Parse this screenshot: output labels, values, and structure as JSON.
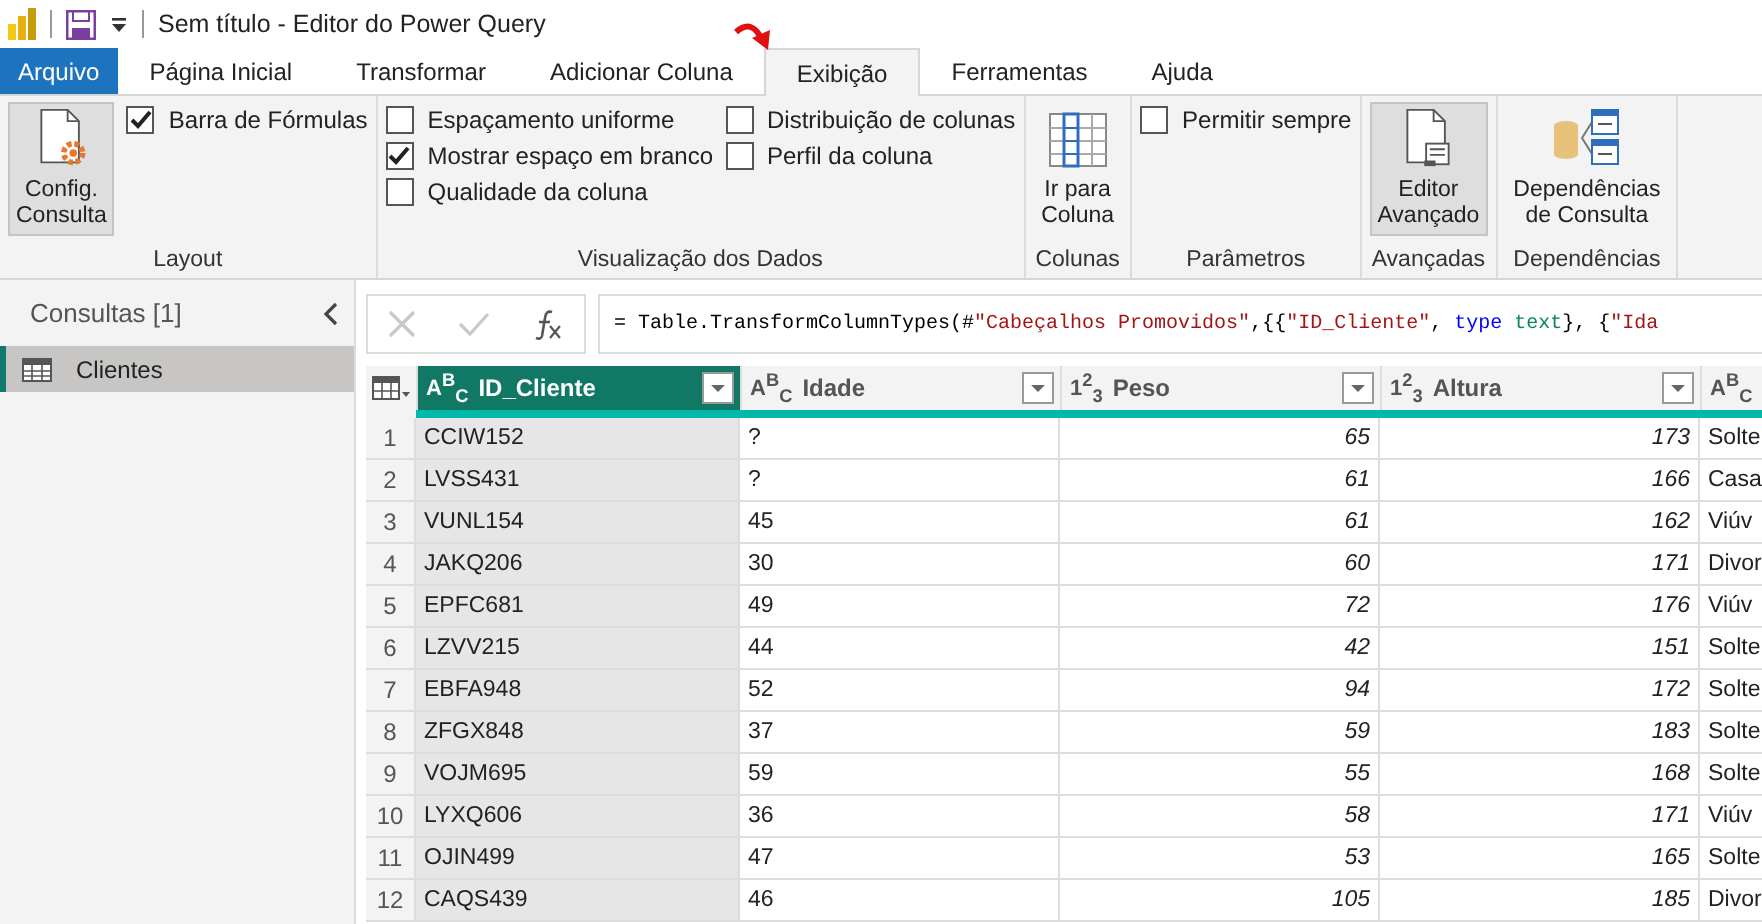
{
  "window": {
    "title": "Sem título - Editor do Power Query"
  },
  "tabs": [
    {
      "label": "Arquivo",
      "kind": "file",
      "selected": false
    },
    {
      "label": "Página Inicial",
      "kind": "tab",
      "selected": false
    },
    {
      "label": "Transformar",
      "kind": "tab",
      "selected": false
    },
    {
      "label": "Adicionar Coluna",
      "kind": "tab",
      "selected": false
    },
    {
      "label": "Exibição",
      "kind": "tab",
      "selected": true
    },
    {
      "label": "Ferramentas",
      "kind": "tab",
      "selected": false
    },
    {
      "label": "Ajuda",
      "kind": "tab",
      "selected": false
    }
  ],
  "ribbon": {
    "groups": [
      {
        "label": "Layout",
        "items": [
          {
            "kind": "big_button",
            "lines": [
              "Config.",
              "Consulta"
            ],
            "selected": true
          },
          {
            "kind": "checks",
            "checkboxes": [
              {
                "label": "Barra de Fórmulas",
                "checked": true
              }
            ]
          }
        ]
      },
      {
        "label": "Visualização dos Dados",
        "items": [
          {
            "kind": "checks",
            "checkboxes": [
              {
                "label": "Espaçamento uniforme",
                "checked": false
              },
              {
                "label": "Mostrar espaço em branco",
                "checked": true
              },
              {
                "label": "Qualidade da coluna",
                "checked": false
              }
            ]
          },
          {
            "kind": "checks",
            "checkboxes": [
              {
                "label": "Distribuição de colunas",
                "checked": false
              },
              {
                "label": "Perfil da coluna",
                "checked": false
              }
            ]
          }
        ]
      },
      {
        "label": "Colunas",
        "items": [
          {
            "kind": "big_button",
            "lines": [
              "Ir para",
              "Coluna"
            ],
            "selected": false
          }
        ]
      },
      {
        "label": "Parâmetros",
        "items": [
          {
            "kind": "checks",
            "checkboxes": [
              {
                "label": "Permitir sempre",
                "checked": false
              }
            ]
          }
        ]
      },
      {
        "label": "Avançadas",
        "items": [
          {
            "kind": "big_button",
            "lines": [
              "Editor",
              "Avançado"
            ],
            "selected": true
          }
        ]
      },
      {
        "label": "Dependências",
        "items": [
          {
            "kind": "big_button",
            "lines": [
              "Dependências",
              "de Consulta"
            ],
            "selected": false
          }
        ]
      }
    ]
  },
  "sidebar": {
    "title": "Consultas [1]",
    "items": [
      {
        "label": "Clientes",
        "selected": true
      }
    ]
  },
  "formula_bar": {
    "segments": [
      {
        "kind": "plain",
        "text": "= Table.TransformColumnTypes(#"
      },
      {
        "kind": "string",
        "text": "\"Cabeçalhos Promovidos\""
      },
      {
        "kind": "plain",
        "text": ",{{"
      },
      {
        "kind": "string",
        "text": "\"ID_Cliente\""
      },
      {
        "kind": "plain",
        "text": ", "
      },
      {
        "kind": "keyword",
        "text": "type"
      },
      {
        "kind": "type",
        "text": " text"
      },
      {
        "kind": "plain",
        "text": "}, {"
      },
      {
        "kind": "string",
        "text": "\"Ida"
      }
    ]
  },
  "table": {
    "columns": [
      {
        "label": "ID_Cliente",
        "kind": "text",
        "type_label": "A$^{B}$$_{C}$",
        "selected": true
      },
      {
        "label": "Idade",
        "kind": "text",
        "type_label": "A$^{B}$$_{C}$",
        "selected": false
      },
      {
        "label": "Peso",
        "kind": "number",
        "type_label": "1$^{2}$$_{3}$",
        "selected": false
      },
      {
        "label": "Altura",
        "kind": "number",
        "type_label": "1$^{2}$$_{3}$",
        "selected": false
      },
      {
        "kind": "text",
        "type_label": "A$^{B}$$_{C}$",
        "selected": false
      }
    ],
    "rows": [
      {
        "n": "1",
        "cells": [
          "CCIW152",
          "?",
          "65",
          "173",
          "Solte"
        ]
      },
      {
        "n": "2",
        "cells": [
          "LVSS431",
          "?",
          "61",
          "166",
          "Casa"
        ]
      },
      {
        "n": "3",
        "cells": [
          "VUNL154",
          "45",
          "61",
          "162",
          "Viúv"
        ]
      },
      {
        "n": "4",
        "cells": [
          "JAKQ206",
          "30",
          "60",
          "171",
          "Divor"
        ]
      },
      {
        "n": "5",
        "cells": [
          "EPFC681",
          "49",
          "72",
          "176",
          "Viúv"
        ]
      },
      {
        "n": "6",
        "cells": [
          "LZVV215",
          "44",
          "42",
          "151",
          "Solte"
        ]
      },
      {
        "n": "7",
        "cells": [
          "EBFA948",
          "52",
          "94",
          "172",
          "Solte"
        ]
      },
      {
        "n": "8",
        "cells": [
          "ZFGX848",
          "37",
          "59",
          "183",
          "Solte"
        ]
      },
      {
        "n": "9",
        "cells": [
          "VOJM695",
          "59",
          "55",
          "168",
          "Solte"
        ]
      },
      {
        "n": "10",
        "cells": [
          "LYXQ606",
          "36",
          "58",
          "171",
          "Viúv"
        ]
      },
      {
        "n": "11",
        "cells": [
          "OJIN499",
          "47",
          "53",
          "165",
          "Solte"
        ]
      },
      {
        "n": "12",
        "cells": [
          "CAQS439",
          "46",
          "105",
          "185",
          "Divor"
        ]
      }
    ]
  }
}
